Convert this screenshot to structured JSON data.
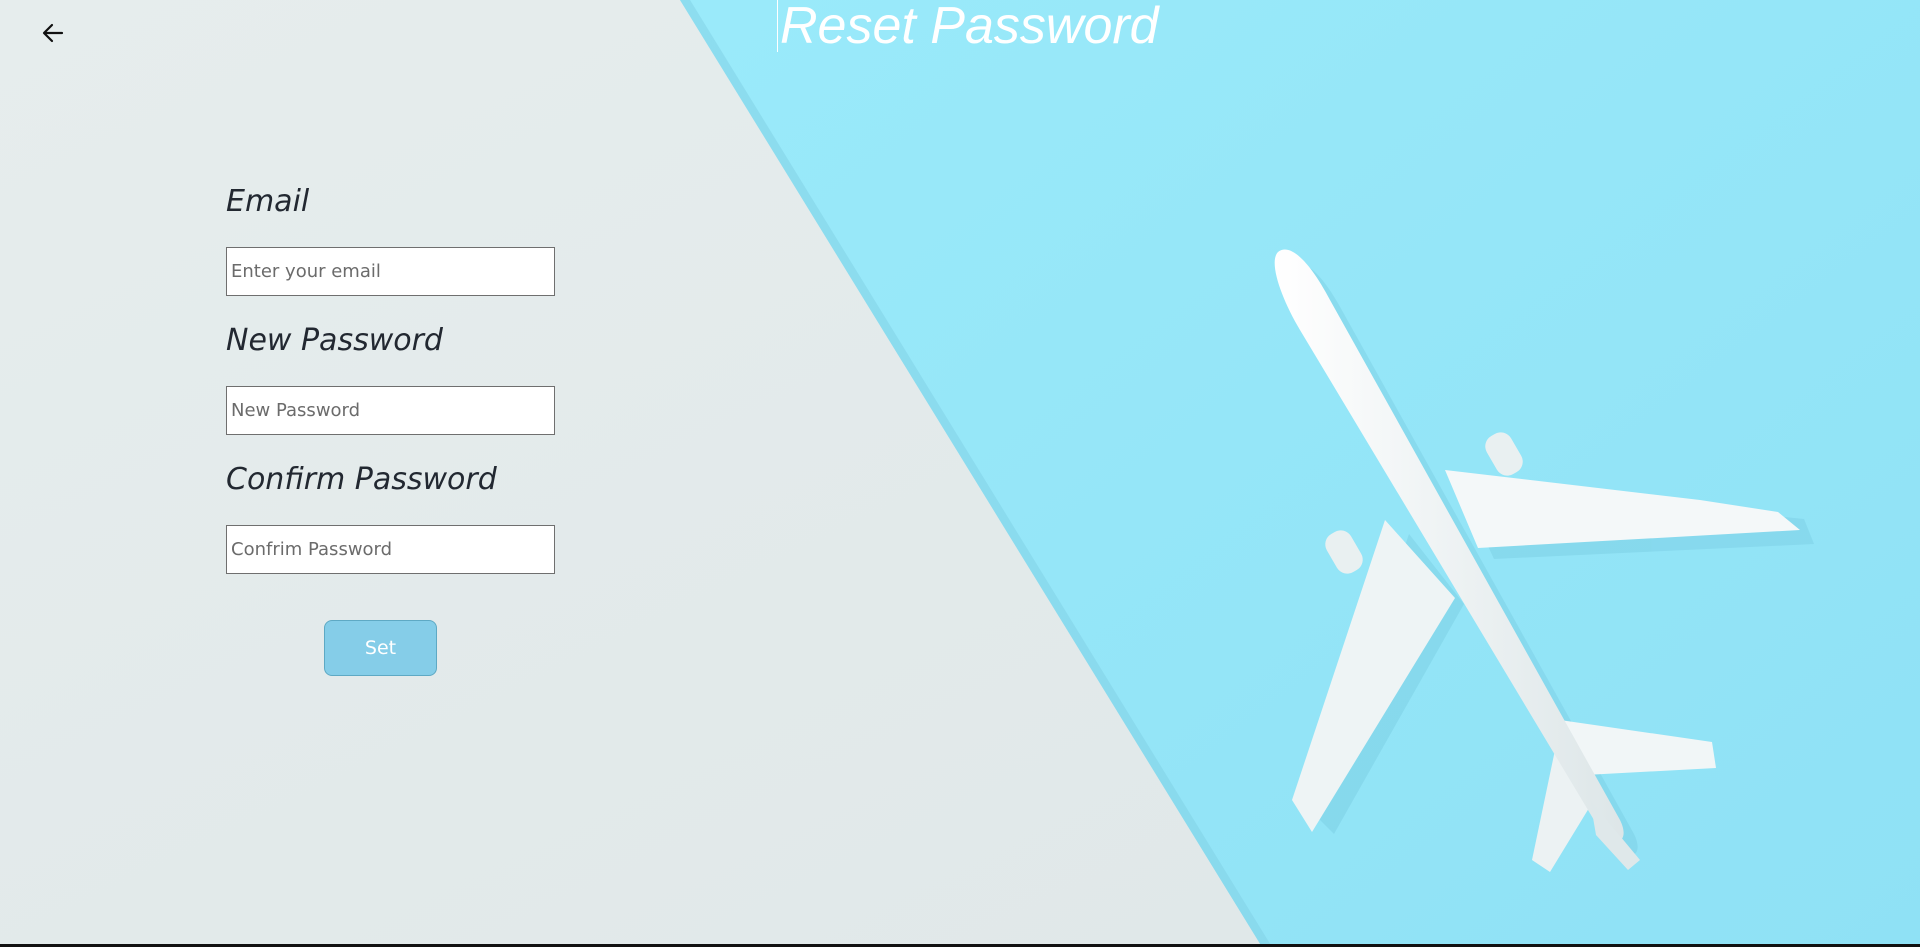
{
  "header": {
    "title": "Reset Password",
    "back_icon": "arrow-left-icon"
  },
  "form": {
    "email": {
      "label": "Email",
      "placeholder": "Enter your email",
      "value": ""
    },
    "new_password": {
      "label": "New Password",
      "placeholder": "New Password",
      "value": ""
    },
    "confirm_password": {
      "label": "Confirm Password",
      "placeholder": "Confrim Password",
      "value": ""
    },
    "submit_label": "Set"
  },
  "background": {
    "image": "airplane-illustration",
    "colors": {
      "left_panel": "#e3eaeb",
      "right_panel": "#97e6f6",
      "airplane": "#f2f6f7",
      "button": "#85cde8"
    }
  }
}
